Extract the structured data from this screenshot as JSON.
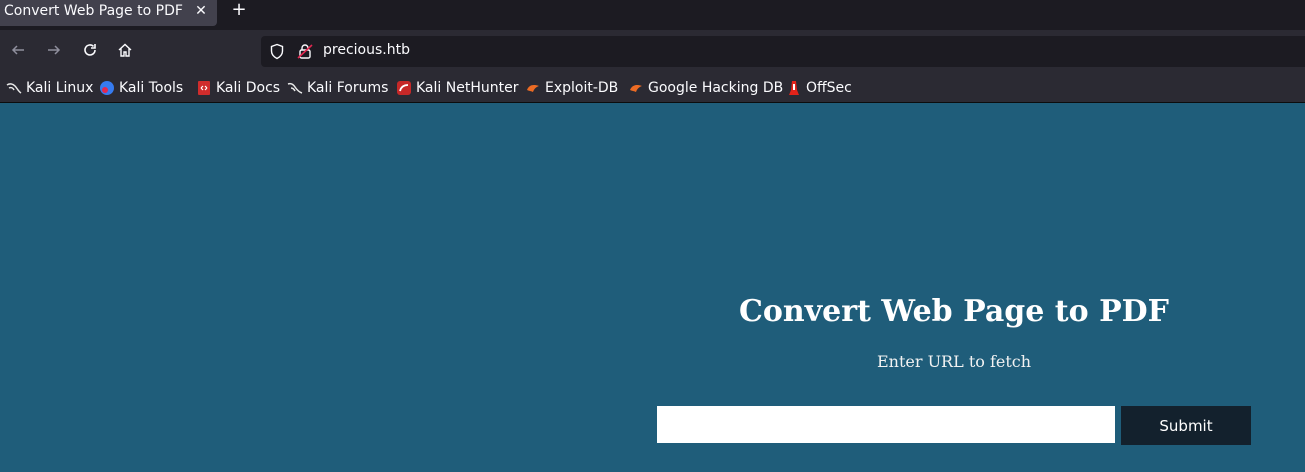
{
  "browser": {
    "tab_title": "Convert Web Page to PDF",
    "tab_close": "✕",
    "new_tab": "+",
    "url": "precious.htb",
    "bookmarks": [
      {
        "label": "Kali Linux",
        "icon": "kali-dragon-icon"
      },
      {
        "label": "Kali Tools",
        "icon": "kali-tools-icon"
      },
      {
        "label": "Kali Docs",
        "icon": "kali-docs-icon"
      },
      {
        "label": "Kali Forums",
        "icon": "kali-forums-icon"
      },
      {
        "label": "Kali NetHunter",
        "icon": "kali-nethunter-icon"
      },
      {
        "label": "Exploit-DB",
        "icon": "exploit-db-icon"
      },
      {
        "label": "Google Hacking DB",
        "icon": "ghdb-icon"
      },
      {
        "label": "OffSec",
        "icon": "offsec-icon"
      }
    ]
  },
  "page": {
    "heading": "Convert Web Page to PDF",
    "subheading": "Enter URL to fetch",
    "input_value": "",
    "submit_label": "Submit"
  },
  "colors": {
    "page_background": "#1f5d7a",
    "submit_background": "#13212d"
  }
}
